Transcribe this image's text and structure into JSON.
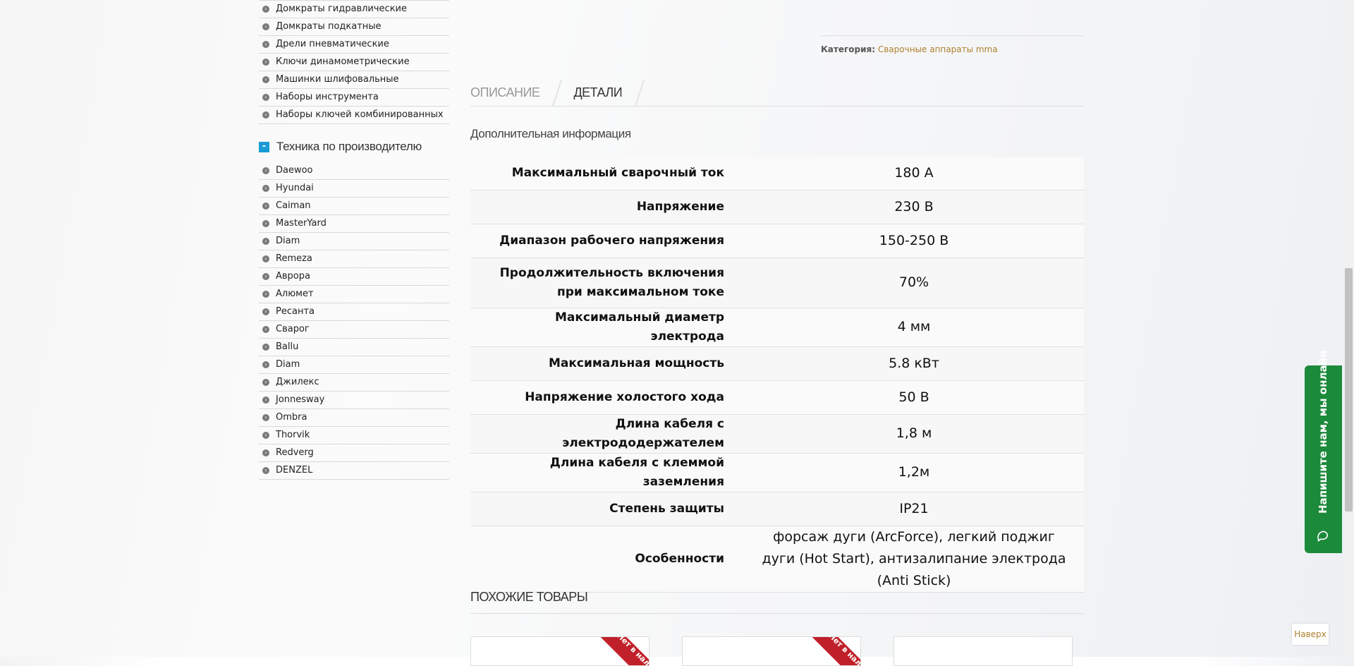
{
  "sidebar": {
    "tools": [
      "Домкраты гидравлические",
      "Домкраты подкатные",
      "Дрели пневматические",
      "Ключи динамометрические",
      "Машинки шлифовальные",
      "Наборы инструмента",
      "Наборы ключей комбинированных"
    ],
    "group_title": "Техника по производителю",
    "manufacturers": [
      "Daewoo",
      "Hyundai",
      "Caiman",
      "MasterYard",
      "Diam",
      "Remeza",
      "Аврора",
      "Алюмет",
      "Ресанта",
      "Сварог",
      "Ballu",
      "Diam",
      "Джилекс",
      "Jonnesway",
      "Ombra",
      "Thorvik",
      "Redverg",
      "DENZEL"
    ]
  },
  "product": {
    "category_label": "Категория:",
    "category_value": "Сварочные аппараты mma",
    "tabs": {
      "description": "ОПИСАНИЕ",
      "details": "ДЕТАЛИ"
    },
    "addinfo_title": "Дополнительная информация",
    "specs": [
      {
        "k": "Максимальный сварочный ток",
        "v": "180 А"
      },
      {
        "k": "Напряжение",
        "v": "230 В"
      },
      {
        "k": "Диапазон рабочего напряжения",
        "v": "150-250 В"
      },
      {
        "k": "Продолжительность включения при максимальном токе",
        "v": "70%"
      },
      {
        "k": "Максимальный диаметр электрода",
        "v": "4 мм"
      },
      {
        "k": "Максимальная мощность",
        "v": "5.8 кВт"
      },
      {
        "k": "Напряжение холостого хода",
        "v": "50 В"
      },
      {
        "k": "Длина кабеля с электрододержателем",
        "v": "1,8 м"
      },
      {
        "k": "Длина кабеля с клеммой заземления",
        "v": "1,2м"
      },
      {
        "k": "Степень защиты",
        "v": "IP21"
      },
      {
        "k": "Особенности",
        "v": "форсаж дуги (ArcForce), легкий поджиг дуги (Hot Start), антизалипание электрода (Anti Stick)"
      }
    ],
    "similar_title": "ПОХОЖИЕ ТОВАРЫ",
    "ribbon_text": "Нет в нал"
  },
  "widgets": {
    "chat_text": "Напишите нам, мы онлайн",
    "to_top": "Наверх"
  },
  "icons": {
    "bullet": "chevron-right-icon",
    "chat": "chat-bubble-icon",
    "minus": "minus-icon"
  }
}
